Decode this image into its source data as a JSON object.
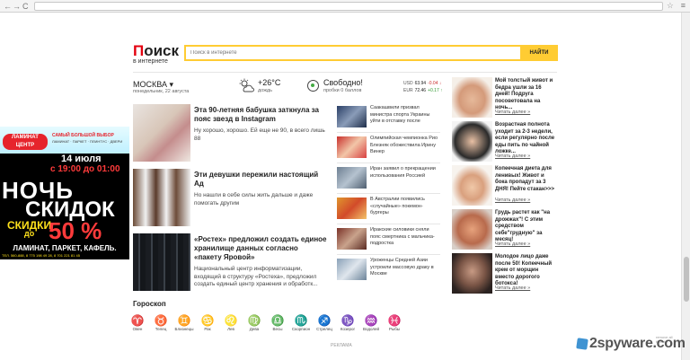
{
  "browser": {
    "back": "←",
    "forward": "→",
    "reload": "C",
    "star": "☆",
    "menu": "≡"
  },
  "logo": {
    "first_letter": "П",
    "rest": "оиск",
    "sub": "в интернете"
  },
  "search": {
    "placeholder": "Поиск в интернете",
    "button": "НАЙТИ"
  },
  "city": {
    "name": "МОСКВА",
    "arrow": "▾",
    "date": "понедельник, 22 августа"
  },
  "weather": {
    "icon": "sun-cloud-icon",
    "temp": "+26°C",
    "desc": "дождь"
  },
  "traffic": {
    "icon": "traffic-icon",
    "status": "Свободно!",
    "score": "пробки 0 баллов"
  },
  "rates": [
    {
      "cur": "USD",
      "value": "63.94",
      "change": "-0.04 ↓",
      "dir": "down"
    },
    {
      "cur": "EUR",
      "value": "72.46",
      "change": "+0.17 ↑",
      "dir": "up"
    }
  ],
  "left_ad": {
    "brand": "ЛАМИНАТ ЦЕНТР",
    "slogan": "САМЫЙ БОЛЬШОЙ ВЫБОР",
    "sub": "ЛАМИНАТ · ПАРКЕТ · ПЛИНТУС · ДВЕРИ",
    "date": "14 июля",
    "time": "с 19:00 до 01:00",
    "word1": "НОЧЬ",
    "word2": "СКИДОК",
    "discount_label": "СКИДКИ",
    "upto": "до",
    "percent": "50 %",
    "goods": "ЛАМИНАТ, ПАРКЕТ, КАФЕЛЬ.",
    "address": "ТЕЛ. 560-888, 8 775 198 49 28, 8 701 221 81 45"
  },
  "news": [
    {
      "title": "Эта 90-летняя бабушка заткнула за пояс звезд в Instagram",
      "snippet": "Ну хорошо, хорошо. Ей еще не 90, в всего лишь 88"
    },
    {
      "title": "Эти девушки пережили настоящий Ад",
      "snippet": "Но нашли в себе силы жить дальше и даже помогать другим"
    },
    {
      "title": "«Ростех» предложил создать единое хранилище данных согласно «пакету Яровой»",
      "snippet": "Национальный центр информатизации, входящий в структуру «Ростеха», предложил создать единый центр хранения и обработк..."
    }
  ],
  "side_news": [
    "Саакашвили призвал министра спорта Украины уйти в отставку после",
    "Олимпийская чемпионка Рио Блезняк обожествила Ирину Винер",
    "Иран заявил о прекращении использования Россией",
    "В Австралии появились «случайные» покемон-бургеры",
    "Иракские силовики сняли пояс смертника с мальчика-подростка",
    "Уроженцы Средней Азии устроили массовую драку в Москве"
  ],
  "right_ads": [
    {
      "text": "Мой толстый живот и бедра ушли за 16 дней! Подруга посоветовала на ночь...",
      "more": "Читать далее »"
    },
    {
      "text": "Возрастная полнота уходит за 2-3 недели, если регулярно после еды пить по чайной ложке...",
      "more": "Читать далее »"
    },
    {
      "text": "Копеечная диета для ленивых! Живот и бока пропадут за 3 ДНЯ! Пейте стакан>>>",
      "more": "Читать далее »"
    },
    {
      "text": "Грудь растет как \"на дрожжах\"! С этим средством себе\"грудную\" за месяц!",
      "more": "Читать далее »"
    },
    {
      "text": "Молодое лицо даже после 50! Копеечный крем от морщин вместо дорогого ботокса!",
      "more": "Читать далее »"
    }
  ],
  "horoscope": {
    "title": "Гороскоп",
    "signs": [
      {
        "glyph": "♈",
        "name": "Овен",
        "icon": "aries-icon"
      },
      {
        "glyph": "♉",
        "name": "Телец",
        "icon": "taurus-icon"
      },
      {
        "glyph": "♊",
        "name": "Близнецы",
        "icon": "gemini-icon"
      },
      {
        "glyph": "♋",
        "name": "Рак",
        "icon": "cancer-icon"
      },
      {
        "glyph": "♌",
        "name": "Лев",
        "icon": "leo-icon"
      },
      {
        "glyph": "♍",
        "name": "Дева",
        "icon": "virgo-icon"
      },
      {
        "glyph": "♎",
        "name": "Весы",
        "icon": "libra-icon"
      },
      {
        "glyph": "♏",
        "name": "Скорпион",
        "icon": "scorpio-icon"
      },
      {
        "glyph": "♐",
        "name": "Стрелец",
        "icon": "sagittarius-icon"
      },
      {
        "glyph": "♑",
        "name": "Козерог",
        "icon": "capricorn-icon"
      },
      {
        "glyph": "♒",
        "name": "Водолей",
        "icon": "aquarius-icon"
      },
      {
        "glyph": "♓",
        "name": "Рыбы",
        "icon": "pisces-icon"
      }
    ]
  },
  "footer": {
    "reklama": "РЕКЛАМА"
  },
  "watermark": {
    "text": "2spyware.com",
    "small": "remove all threats"
  },
  "colors": {
    "accent_yellow": "#ffcc33",
    "logo_red": "#e3000f",
    "text": "#222222"
  }
}
